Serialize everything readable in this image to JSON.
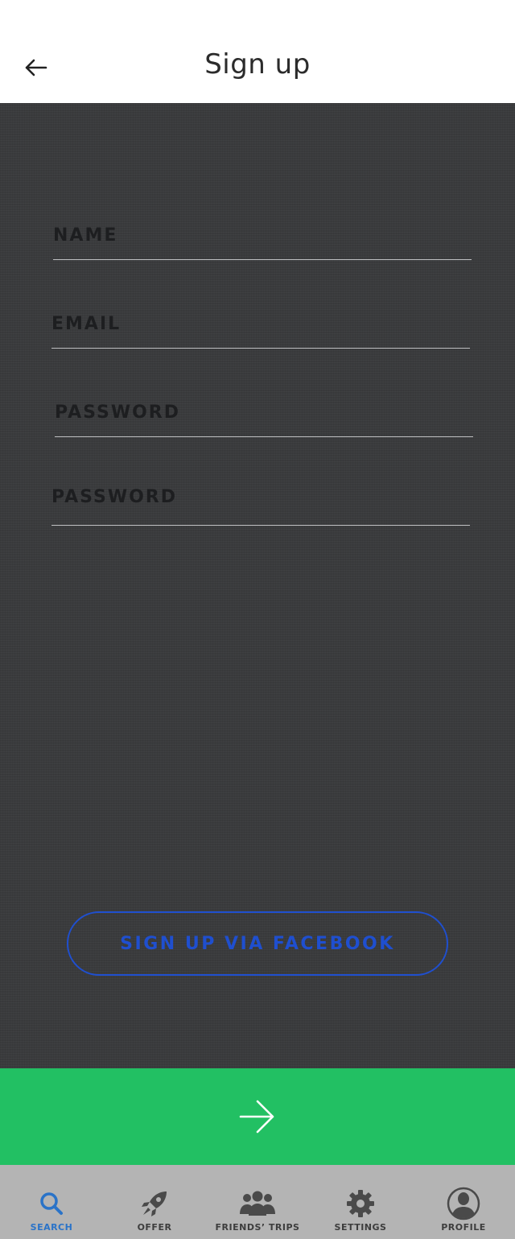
{
  "header": {
    "title": "Sign up",
    "back_icon": "arrow-left-icon"
  },
  "form": {
    "fields": [
      {
        "label": "NAME"
      },
      {
        "label": "EMAIL"
      },
      {
        "label": "PASSWORD"
      },
      {
        "label": "PASSWORD"
      }
    ],
    "facebook_button_label": "SIGN UP VIA FACEBOOK",
    "next_icon": "arrow-right-icon"
  },
  "nav": {
    "items": [
      {
        "label": "SEARCH",
        "icon": "search-icon",
        "active": true
      },
      {
        "label": "OFFER",
        "icon": "rocket-icon",
        "active": false
      },
      {
        "label": "FRIENDS’ TRIPS",
        "icon": "group-icon",
        "active": false
      },
      {
        "label": "SETTINGS",
        "icon": "gear-icon",
        "active": false
      },
      {
        "label": "PROFILE",
        "icon": "profile-icon",
        "active": false
      }
    ]
  },
  "colors": {
    "form_background": "#3a3b3d",
    "accent_green": "#22c063",
    "facebook_blue": "#1f4fcf",
    "nav_background": "#b4b4b4",
    "nav_active": "#2a73c8"
  }
}
